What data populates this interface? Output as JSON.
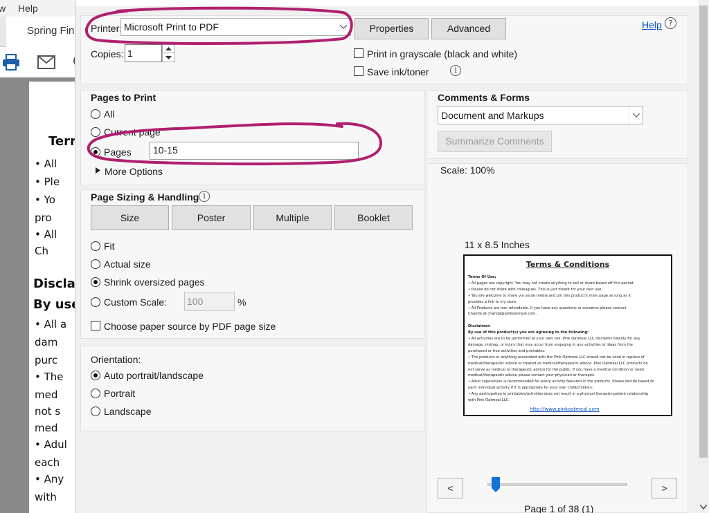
{
  "background_app": {
    "menu_items": [
      "w",
      "Help"
    ],
    "tab_label": "Spring Fin",
    "doc_lines": [
      {
        "text": "Terr",
        "bold": true
      },
      {
        "text": "•  All"
      },
      {
        "text": "•  Ple"
      },
      {
        "text": "•  Yo"
      },
      {
        "text": "    pro"
      },
      {
        "text": "•  All"
      },
      {
        "text": "    Ch"
      },
      {
        "text": "Disclai",
        "bold": true
      },
      {
        "text": "By use",
        "bold": true
      },
      {
        "text": "•  All a"
      },
      {
        "text": "    dam"
      },
      {
        "text": "    purc"
      },
      {
        "text": "•  The"
      },
      {
        "text": "    med"
      },
      {
        "text": "    not s"
      },
      {
        "text": "    med"
      },
      {
        "text": "•  Adul"
      },
      {
        "text": "    each"
      },
      {
        "text": "•  Any"
      },
      {
        "text": "    with"
      }
    ]
  },
  "dialog": {
    "printer_label": "Printer:",
    "printer_value": "Microsoft Print to PDF",
    "properties_label": "Properties",
    "advanced_label": "Advanced",
    "help_label": "Help",
    "copies_label": "Copies:",
    "copies_value": "1",
    "grayscale_label": "Print in grayscale (black and white)",
    "save_ink_label": "Save ink/toner",
    "pages_to_print": {
      "title": "Pages to Print",
      "all_label": "All",
      "current_label": "Current page",
      "pages_label": "Pages",
      "pages_value": "10-15",
      "more_options_label": "More Options",
      "selected": "Pages"
    },
    "page_sizing": {
      "title": "Page Sizing & Handling",
      "tabs": [
        "Size",
        "Poster",
        "Multiple",
        "Booklet"
      ],
      "fit_label": "Fit",
      "actual_label": "Actual size",
      "shrink_label": "Shrink oversized pages",
      "custom_label": "Custom Scale:",
      "custom_value": "100",
      "percent": "%",
      "paper_source_label": "Choose paper source by PDF page size",
      "selected": "Shrink oversized pages"
    },
    "orientation": {
      "title": "Orientation:",
      "auto_label": "Auto portrait/landscape",
      "portrait_label": "Portrait",
      "landscape_label": "Landscape",
      "selected": "Auto portrait/landscape"
    },
    "comments_forms": {
      "title": "Comments & Forms",
      "value": "Document and Markups",
      "summarize_label": "Summarize Comments"
    },
    "preview": {
      "scale_label": "Scale: 100%",
      "paper_size": "11 x 8.5 Inches",
      "prev_label": "<",
      "next_label": ">",
      "page_indicator": "Page 1 of 38 (1)",
      "slider_position": 0.03
    },
    "preview_page": {
      "title": "Terms & Conditions",
      "lines": [
        {
          "text": "Terms Of Use:",
          "bold": true
        },
        {
          "text": "•  All pages are copyright. You may not create anything to sell or share based off this packet."
        },
        {
          "text": "•  Please do not share with colleagues. This is just meant for your own use."
        },
        {
          "text": "•  You are welcome to share via social media and pin this product's main page as long as it"
        },
        {
          "text": "    provides a link to my store."
        },
        {
          "text": "•  All Products are non-refundable. If you have any questions or concerns please contact"
        },
        {
          "text": "    Chanda at chanda@pinkoatmeal.com."
        },
        {
          "text": ""
        },
        {
          "text": "Disclaimer:",
          "bold": true
        },
        {
          "text": "By use of this product(s) you are agreeing to the following:",
          "bold": true
        },
        {
          "text": "•  All activities are to be performed at your own risk. Pink Oatmeal LLC disclaims liability for any"
        },
        {
          "text": "    damage, mishap, or injury that may occur from engaging in any activities or ideas from the"
        },
        {
          "text": "    purchased or free activities and printables."
        },
        {
          "text": "•  The products or anything associated with the Pink Oatmeal LLC should not be used in replace of"
        },
        {
          "text": "    medical/therapeutic advice or treated as medical/therapeutic advice.  Pink Oatmeal LLC products do"
        },
        {
          "text": "    not serve as medical or therapeutic advice for the public. If you have a medical condition or need"
        },
        {
          "text": "    medical/therapeutic advice please contact your physician or therapist."
        },
        {
          "text": "•  Adult supervision is recommended for every activity featured in the products. Please decide based on"
        },
        {
          "text": "    each individual activity if it is appropriate for your own child/children."
        },
        {
          "text": "•  Any participation in printables/activities does not result in a physical therapist-patient relationship"
        },
        {
          "text": "    with Pink Oatmeal LLC."
        }
      ],
      "link": "http://www.pinkoatmeal.com"
    }
  },
  "colors": {
    "annotation": "#b0206e",
    "link": "#0b54c7",
    "slider": "#1273d6"
  }
}
